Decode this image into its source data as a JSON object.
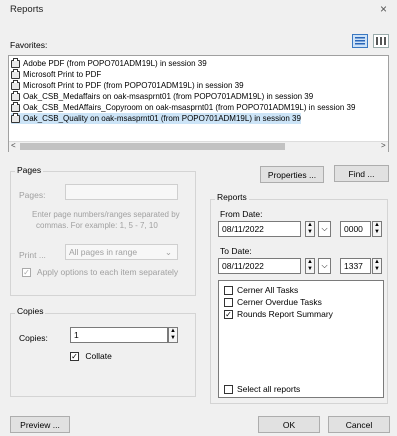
{
  "window": {
    "title": "Reports",
    "close_glyph": "×"
  },
  "favorites": {
    "label": "Favorites:",
    "printers": [
      "Adobe PDF (from POPO701ADM19L) in session 39",
      "Microsoft Print to PDF",
      "Microsoft Print to PDF (from POPO701ADM19L) in session 39",
      "Oak_CSB_Medaffairs on oak-msasprnt01 (from POPO701ADM19L) in session 39",
      "Oak_CSB_MedAffairs_Copyroom on oak-msasprnt01 (from POPO701ADM19L) in session 39",
      "Oak_CSB_Quality on oak-msasprnt01 (from POPO701ADM19L) in session 39"
    ],
    "selected_index": 5,
    "scroll_left": "<",
    "scroll_right": ">"
  },
  "pages": {
    "group_label": "Pages",
    "pages_label": "Pages:",
    "pages_value": "",
    "hint_line1": "Enter page numbers/ranges separated by",
    "hint_line2": "commas.  For example:  1, 5 - 7, 10",
    "print_label": "Print ...",
    "print_option": "All pages in range",
    "apply_label": "Apply options to each item separately"
  },
  "copies": {
    "group_label": "Copies",
    "copies_label": "Copies:",
    "copies_value": "1",
    "collate_label": "Collate",
    "collate_checked": true
  },
  "buttons": {
    "properties": "Properties ...",
    "find": "Find ...",
    "preview": "Preview ...",
    "ok": "OK",
    "cancel": "Cancel"
  },
  "reports": {
    "group_label": "Reports",
    "from_label": "From Date:",
    "from_date": "08/11/2022",
    "from_time": "0000",
    "to_label": "To Date:",
    "to_date": "08/11/2022",
    "to_time": "1337",
    "items": [
      {
        "label": "Cerner All Tasks",
        "checked": false
      },
      {
        "label": "Cerner Overdue Tasks",
        "checked": false
      },
      {
        "label": "Rounds Report Summary",
        "checked": true
      }
    ],
    "select_all_label": "Select all reports"
  },
  "glyphs": {
    "check": "✓",
    "up": "▲",
    "down": "▼",
    "dropdown": "⌄",
    "combo": "⌵"
  }
}
